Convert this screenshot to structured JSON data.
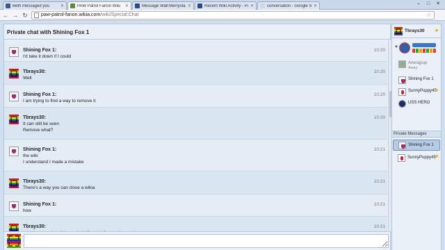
{
  "browser": {
    "tabs": [
      {
        "title": "Beth messaged you",
        "favicon_color": "#3b5998",
        "active": false
      },
      {
        "title": "PAW Patrol Fanon Wiki",
        "favicon_color": "#5e8a3a",
        "active": true
      },
      {
        "title": "Message Wall:Merrystar",
        "favicon_color": "#2a4a8a",
        "active": false
      },
      {
        "title": "Recent Wiki Activity - Pa",
        "favicon_color": "#2a4a8a",
        "active": false
      },
      {
        "title": "conversation - Google S",
        "favicon_color": "#d0d8e4",
        "active": false
      }
    ],
    "url_host": "paw-patrol-fanon.wikia.com",
    "url_path": "/wiki/Special:Chat"
  },
  "chat": {
    "header_title": "Private chat with Shining Fox 1",
    "messages": [
      {
        "user": "Shining Fox 1:",
        "avatar": "fox",
        "lines": [
          "I'd take it down if I could"
        ],
        "time": "10:20"
      },
      {
        "user": "Tbrays30:",
        "avatar": "tb",
        "lines": [
          "Well"
        ],
        "time": "10:20"
      },
      {
        "user": "Shining Fox 1:",
        "avatar": "fox",
        "lines": [
          "I am trying to find a way to remove it"
        ],
        "time": "10:20"
      },
      {
        "user": "Tbrays30:",
        "avatar": "tb",
        "lines": [
          "It can still be seen",
          "Remove what?"
        ],
        "time": "10:20"
      },
      {
        "user": "Shining Fox 1:",
        "avatar": "fox",
        "lines": [
          "the wiki",
          "I understand I made a mistake"
        ],
        "time": "10:21"
      },
      {
        "user": "Tbrays30:",
        "avatar": "tb",
        "lines": [
          "There's a way you can close a wikia"
        ],
        "time": "10:21"
      },
      {
        "user": "Shining Fox 1:",
        "avatar": "fox",
        "lines": [
          "how"
        ],
        "time": "10:21"
      },
      {
        "user": "Tbrays30:",
        "avatar": "tb",
        "lines": [
          "http://community.wikia.com/wiki/Special:Contact/general"
        ],
        "time": "10:21",
        "link": true
      }
    ],
    "input_value": ""
  },
  "rail": {
    "self_name": "Tbrays30",
    "users": [
      {
        "name": "Anerajpup",
        "status": "Away",
        "avatar": "green",
        "away": true,
        "star": false
      },
      {
        "name": "Shining Fox 1",
        "status": "",
        "avatar": "fox",
        "away": false,
        "star": false
      },
      {
        "name": "SunnyPuppy45",
        "status": "",
        "avatar": "sunny",
        "away": false,
        "star": true
      },
      {
        "name": "USS HERO",
        "status": "",
        "avatar": "uss",
        "away": false,
        "star": false
      }
    ],
    "pm_header": "Private Messages",
    "pm_list": [
      {
        "name": "Shining Fox 1",
        "avatar": "fox",
        "selected": true,
        "star": false
      },
      {
        "name": "SunnyPuppy45",
        "avatar": "sunny",
        "selected": false,
        "star": true
      }
    ]
  }
}
